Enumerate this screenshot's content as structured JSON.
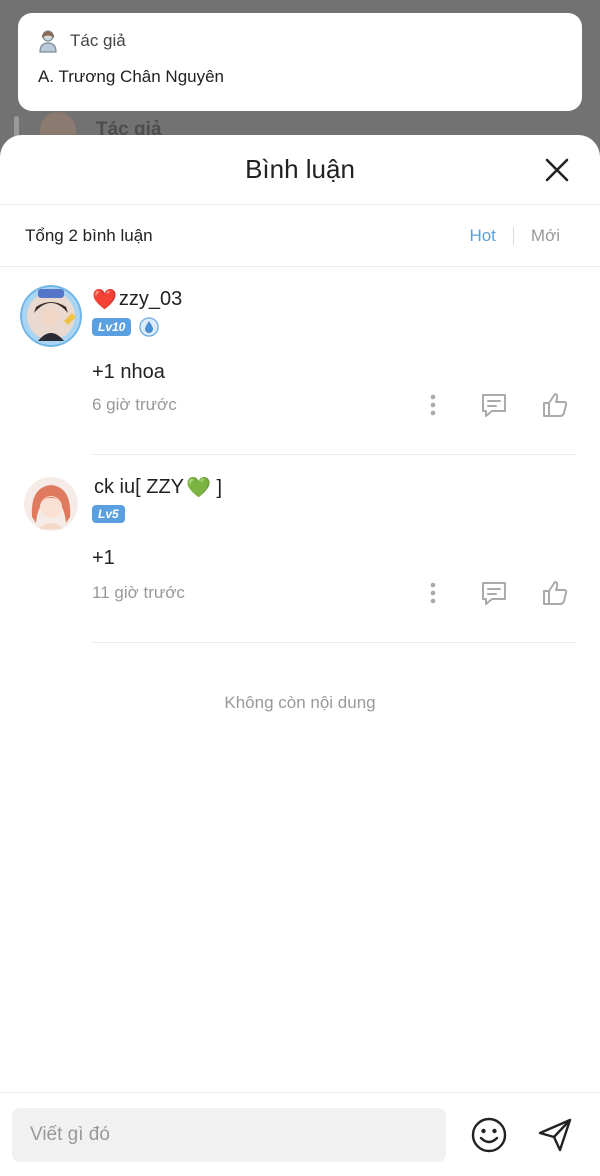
{
  "background": {
    "author_label": "Tác giả"
  },
  "tooltip": {
    "title": "Tác giả",
    "author_name": "A. Trương Chân Nguyên",
    "icon": "person-icon"
  },
  "sheet": {
    "title": "Bình luận",
    "close_icon": "close-icon"
  },
  "summary": {
    "total_text": "Tổng 2 bình luận",
    "sort_tabs": [
      {
        "label": "Hot",
        "active": true
      },
      {
        "label": "Mới",
        "active": false
      }
    ]
  },
  "comments": [
    {
      "user_prefix": "❤️",
      "username": "zzy_03",
      "username_suffix": "",
      "level": "Lv10",
      "has_extra_badge": true,
      "text": "+1 nhoa",
      "time": "6 giờ trước"
    },
    {
      "user_prefix": "",
      "username": "ck iu[ ZZY",
      "username_suffix": "💚 ]",
      "level": "Lv5",
      "has_extra_badge": false,
      "text": "+1",
      "time": "11 giờ trước"
    }
  ],
  "end_text": "Không còn nội dung",
  "input": {
    "placeholder": "Viết gì đó"
  },
  "colors": {
    "accent": "#5aa0e0",
    "muted": "#999999",
    "overlay": "#727272"
  }
}
